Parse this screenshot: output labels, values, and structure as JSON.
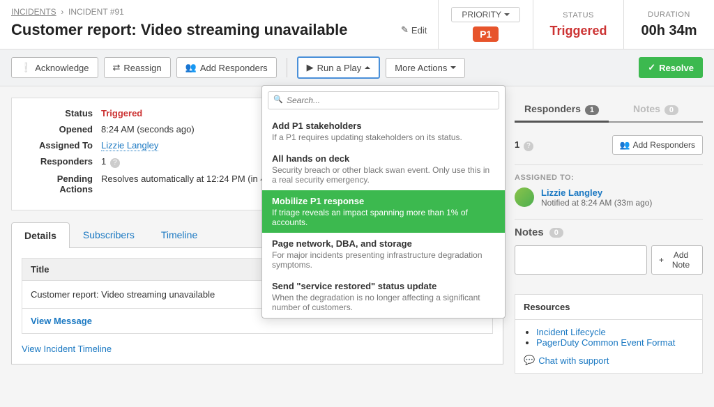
{
  "breadcrumb": {
    "root": "INCIDENTS",
    "current": "INCIDENT #91"
  },
  "title": "Customer report: Video streaming unavailable",
  "edit_label": "Edit",
  "header": {
    "priority_label": "PRIORITY",
    "priority_badge": "P1",
    "status_label": "STATUS",
    "status_value": "Triggered",
    "duration_label": "DURATION",
    "duration_value": "00h 34m"
  },
  "toolbar": {
    "acknowledge": "Acknowledge",
    "reassign": "Reassign",
    "add_responders": "Add Responders",
    "run_play": "Run a Play",
    "more_actions": "More Actions",
    "resolve": "Resolve"
  },
  "info": {
    "status_label": "Status",
    "status_value": "Triggered",
    "opened_label": "Opened",
    "opened_value": "8:24 AM (seconds ago)",
    "assigned_label": "Assigned To",
    "assigned_value": "Lizzie Langley",
    "responders_label": "Responders",
    "responders_value": "1",
    "pending_label": "Pending Actions",
    "pending_value": "Resolves automatically at 12:24 PM (in 4h) if left open."
  },
  "tabs": {
    "details": "Details",
    "subscribers": "Subscribers",
    "timeline": "Timeline"
  },
  "details": {
    "title_label": "Title",
    "title_value": "Customer report: Video streaming unavailable",
    "view_message": "View Message",
    "view_timeline": "View Incident Timeline"
  },
  "dropdown": {
    "search_placeholder": "Search...",
    "items": [
      {
        "title": "Add P1 stakeholders",
        "desc": "If a P1 requires updating stakeholders on its status."
      },
      {
        "title": "All hands on deck",
        "desc": "Security breach or other black swan event. Only use this in a real security emergency."
      },
      {
        "title": "Mobilize P1 response",
        "desc": "If triage reveals an impact spanning more than 1% of accounts."
      },
      {
        "title": "Page network, DBA, and storage",
        "desc": "For major incidents presenting infrastructure degradation symptoms."
      },
      {
        "title": "Send \"service restored\" status update",
        "desc": "When the degradation is no longer affecting a significant number of customers."
      }
    ]
  },
  "side": {
    "responders_tab": "Responders",
    "responders_count": "1",
    "notes_tab": "Notes",
    "notes_count": "0",
    "count_display": "1",
    "add_responders": "Add Responders",
    "assigned_to_label": "ASSIGNED TO:",
    "assignee_name": "Lizzie Langley",
    "assignee_sub": "Notified at 8:24 AM (33m ago)",
    "notes_header": "Notes",
    "notes_badge": "0",
    "add_note": "Add Note"
  },
  "resources": {
    "header": "Resources",
    "link1": "Incident Lifecycle",
    "link2": "PagerDuty Common Event Format",
    "chat": "Chat with support"
  }
}
